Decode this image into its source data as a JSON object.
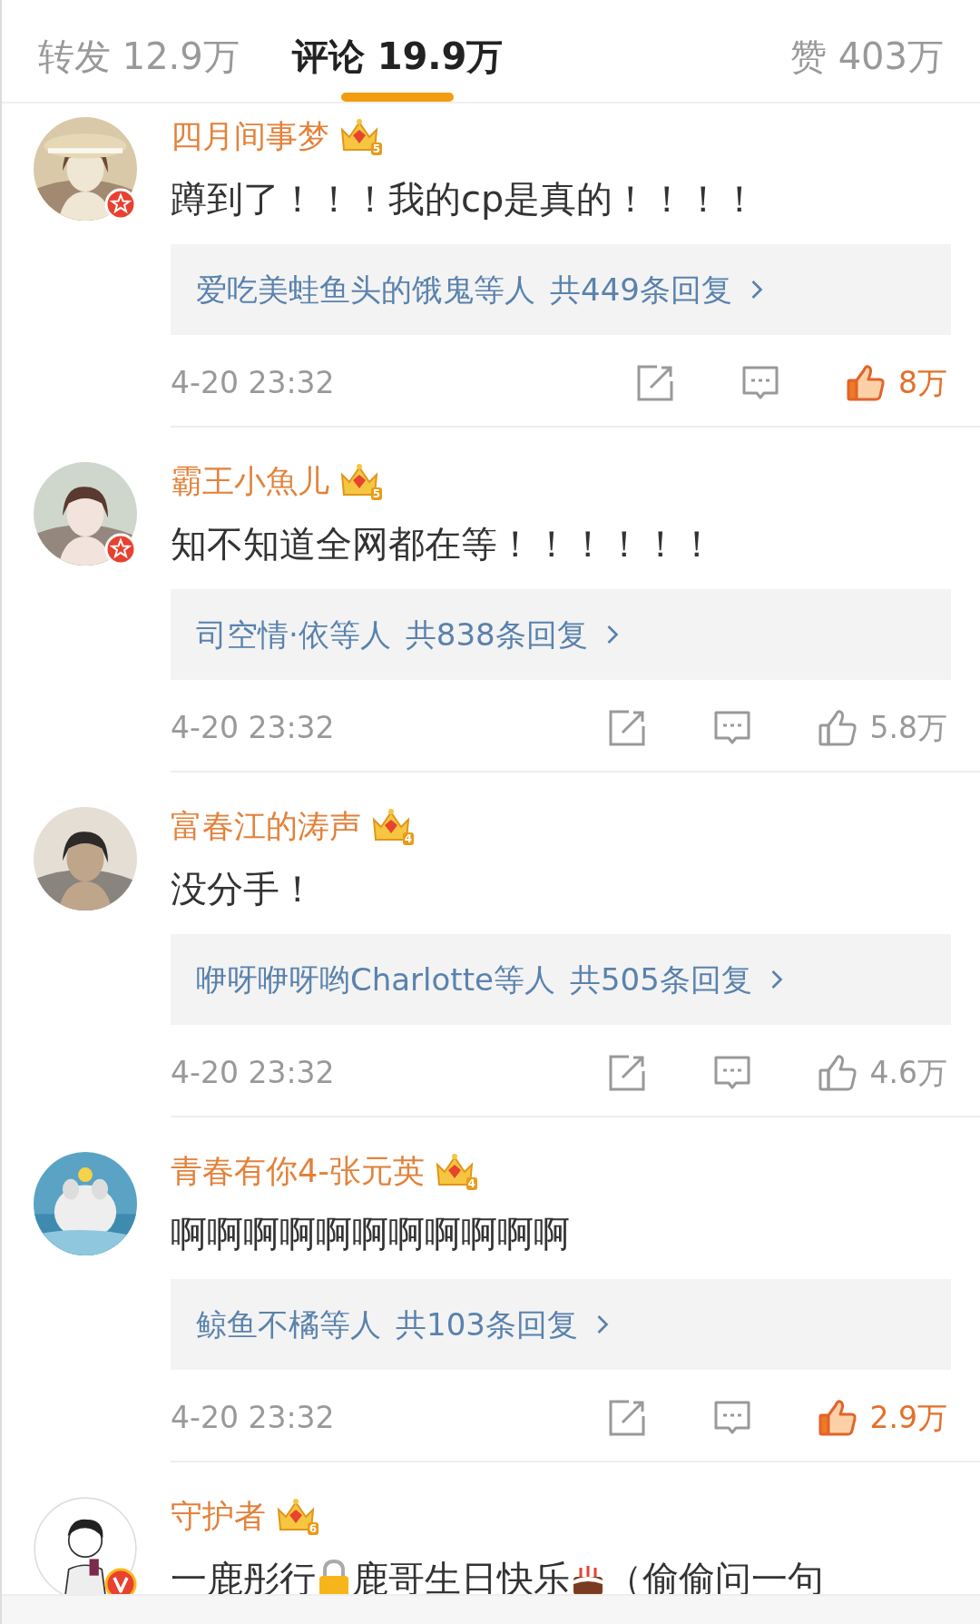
{
  "tabs": [
    {
      "label": "转发 12.9万",
      "selected": false
    },
    {
      "label": "评论 19.9万",
      "selected": true
    },
    {
      "label": "赞 403万",
      "selected": false
    }
  ],
  "comments": [
    {
      "kind": "star",
      "user": "四月间事梦",
      "crown_level": "5",
      "body": [
        "蹲到了！！！我的cp是真的！！！！"
      ],
      "replies": {
        "names": "爱吃美蛙鱼头的饿鬼等人",
        "count": "共449条回复"
      },
      "time": "4-20 23:32",
      "likes": "8万",
      "liked": true
    },
    {
      "kind": "star",
      "user": "霸王小魚儿",
      "crown_level": "5",
      "body": [
        "知不知道全网都在等！！！！！！"
      ],
      "replies": {
        "names": "司空情·依等人",
        "count": "共838条回复"
      },
      "time": "4-20 23:32",
      "likes": "5.8万",
      "liked": false
    },
    {
      "kind": "plain",
      "user": "富春江的涛声",
      "crown_level": "4",
      "body": [
        "没分手！"
      ],
      "replies": {
        "names": "咿呀咿呀哟Charlotte等人",
        "count": "共505条回复"
      },
      "time": "4-20 23:32",
      "likes": "4.6万",
      "liked": false
    },
    {
      "kind": "plain",
      "user": "青春有你4-张元英",
      "crown_level": "4",
      "body": [
        "啊啊啊啊啊啊啊啊啊啊啊"
      ],
      "replies": {
        "names": "鲸鱼不橘等人",
        "count": "共103条回复"
      },
      "time": "4-20 23:32",
      "likes": "2.9万",
      "liked": true
    },
    {
      "kind": "verified",
      "user": "守护者",
      "crown_level": "6",
      "body": [
        "一鹿彤行",
        "鹿哥生日快乐",
        "（偷偷问一句"
      ]
    }
  ]
}
